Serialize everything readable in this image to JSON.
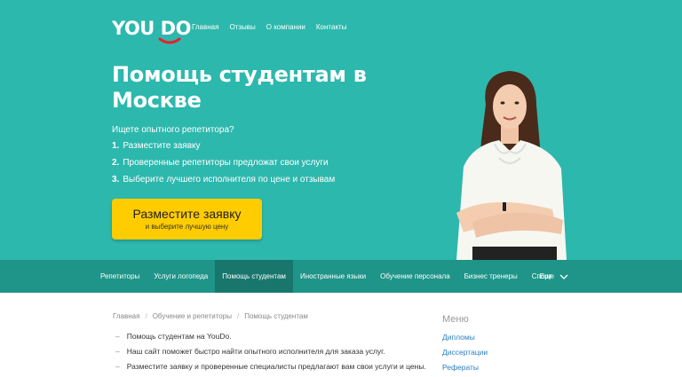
{
  "brand": {
    "logo": "YOU DO",
    "brand_color": "#2db8ad",
    "accent_color": "#e6202c"
  },
  "topnav": {
    "items": [
      {
        "label": "Главная"
      },
      {
        "label": "Отзывы"
      },
      {
        "label": "О компании"
      },
      {
        "label": "Контакты"
      }
    ]
  },
  "hero": {
    "title": "Помощь студентам в Москве",
    "lead": "Ищете опытного репетитора?",
    "steps": [
      {
        "num": "1.",
        "text": "Разместите заявку"
      },
      {
        "num": "2.",
        "text": "Проверенные репетиторы предложат свои услуги"
      },
      {
        "num": "3.",
        "text": "Выберите лучшего исполнителя по цене и отзывам"
      }
    ],
    "cta": {
      "main": "Разместите заявку",
      "sub": "и выберите лучшую цену"
    }
  },
  "categories": {
    "items": [
      {
        "label": "Репетиторы"
      },
      {
        "label": "Услуги логопеда"
      },
      {
        "label": "Помощь студентам"
      },
      {
        "label": "Иностранные языки"
      },
      {
        "label": "Обучение персонала"
      },
      {
        "label": "Бизнес тренеры"
      },
      {
        "label": "Спорт"
      }
    ],
    "active_index": 2,
    "more_label": "Еще"
  },
  "breadcrumbs": [
    {
      "label": "Главная"
    },
    {
      "label": "Обучение и репетиторы"
    },
    {
      "label": "Помощь студентам"
    }
  ],
  "breadcrumb_separator": "/",
  "content": {
    "bullet": "–",
    "items": [
      "Помощь студентам на YouDo.",
      "Наш сайт поможет быстро найти опытного исполнителя для заказа услуг.",
      "Разместите заявку и проверенные специалисты предлагают вам свои услуги и цены."
    ]
  },
  "side_menu": {
    "title": "Меню",
    "links": [
      "Дипломы",
      "Диссертации",
      "Рефераты"
    ]
  }
}
